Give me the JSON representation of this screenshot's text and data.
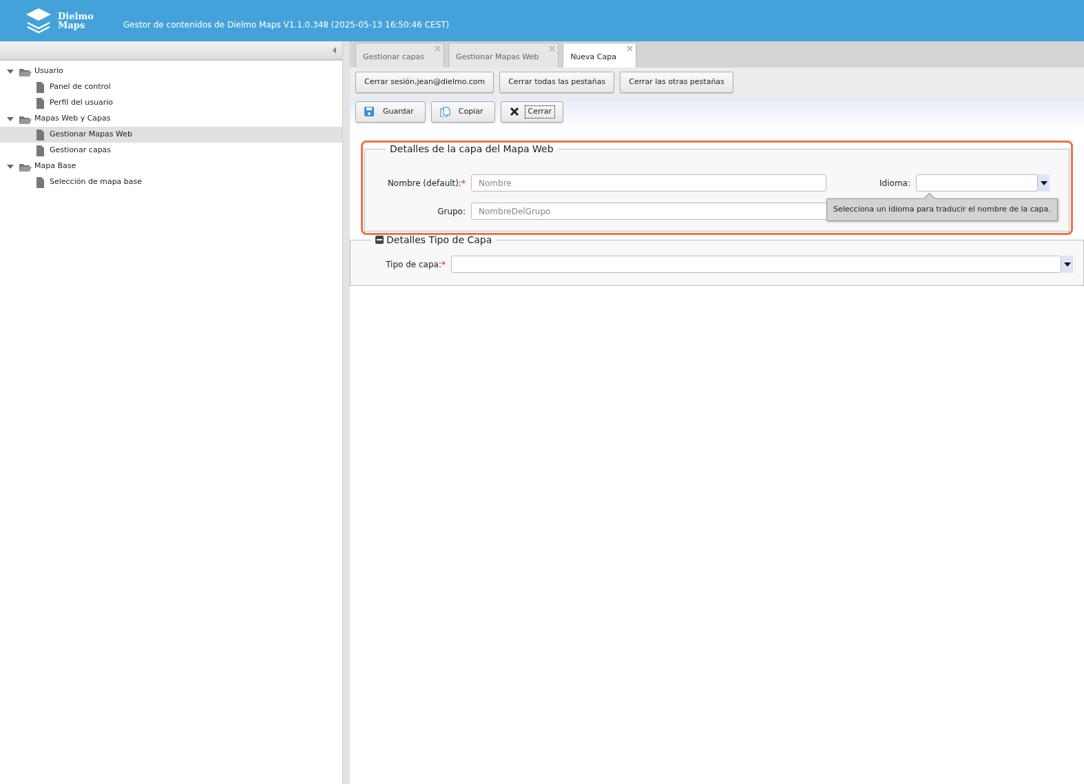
{
  "header": {
    "logo_lines": [
      "Dielmo",
      "Maps"
    ],
    "title": "Gestor de contenidos de Dielmo Maps V1.1.0.348 (2025-05-13 16:50:46 CEST)"
  },
  "sidebar": {
    "tree": [
      {
        "label": "Usuario",
        "expanded": true,
        "children": [
          {
            "label": "Panel de control",
            "selected": false
          },
          {
            "label": "Perfil del usuario",
            "selected": false
          }
        ]
      },
      {
        "label": "Mapas Web y Capas",
        "expanded": true,
        "children": [
          {
            "label": "Gestionar Mapas Web",
            "selected": true
          },
          {
            "label": "Gestionar capas",
            "selected": false
          }
        ]
      },
      {
        "label": "Mapa Base",
        "expanded": true,
        "children": [
          {
            "label": "Selección de mapa base",
            "selected": false
          }
        ]
      }
    ]
  },
  "tabs": [
    {
      "label": "Gestionar capas",
      "selected": false
    },
    {
      "label": "Gestionar Mapas Web",
      "selected": false
    },
    {
      "label": "Nueva Capa",
      "selected": true
    }
  ],
  "session_buttons": [
    "Cerrar sesión,jean@dielmo.com",
    "Cerrar todas las pestañas",
    "Cerrar las otras pestañas"
  ],
  "actions": [
    {
      "label": "Guardar",
      "kind": "save",
      "focused": false
    },
    {
      "label": "Copiar",
      "kind": "copy",
      "focused": false
    },
    {
      "label": "Cerrar",
      "kind": "close",
      "focused": true
    }
  ],
  "layer_details": {
    "legend": "Detalles de la capa del Mapa Web",
    "highlighted": true,
    "name_label": "Nombre (default):",
    "name_required_mark": "*",
    "name_placeholder": "Nombre",
    "language_label": "Idioma:",
    "language_tooltip": "Selecciona un idioma para traducir el nombre de la capa.",
    "group_label": "Grupo:",
    "group_placeholder": "NombreDelGrupo"
  },
  "type_details": {
    "legend": "Detalles Tipo de Capa",
    "expanded": true,
    "type_label": "Tipo de capa:",
    "type_required_mark": "*"
  }
}
